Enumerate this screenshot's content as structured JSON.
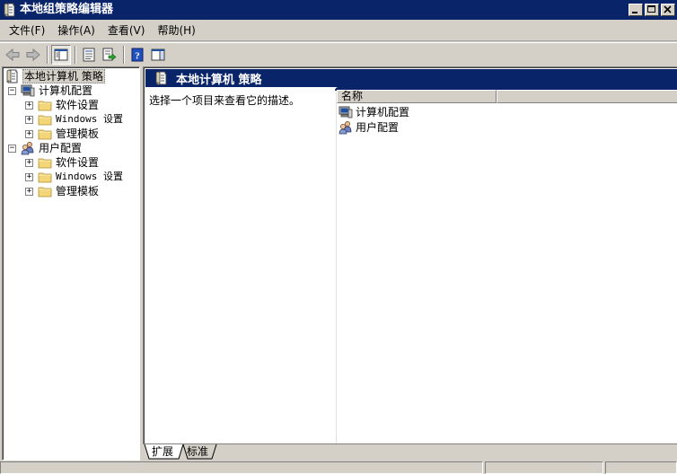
{
  "window": {
    "title": "本地组策略编辑器",
    "icon": "policy-document-icon",
    "buttons": [
      "minimize-icon",
      "maximize-icon",
      "close-icon"
    ]
  },
  "menu": [
    {
      "label": "文件(F)"
    },
    {
      "label": "操作(A)"
    },
    {
      "label": "查看(V)"
    },
    {
      "label": "帮助(H)"
    }
  ],
  "toolbar": {
    "buttons": [
      "back-arrow-icon",
      "forward-arrow-icon",
      "show-hide-tree-icon",
      "properties-icon",
      "export-list-icon",
      "help-icon",
      "show-hide-action-pane-icon"
    ]
  },
  "tree": {
    "root": {
      "label": "本地计算机 策略",
      "icon": "policy-document-icon",
      "selected": true
    },
    "nodes": [
      {
        "label": "计算机配置",
        "icon": "computer-icon",
        "expander": "−",
        "children": [
          {
            "label": "软件设置",
            "icon": "folder-icon",
            "expander": "+"
          },
          {
            "label": "Windows 设置",
            "icon": "folder-icon",
            "expander": "+"
          },
          {
            "label": "管理模板",
            "icon": "folder-icon",
            "expander": "+"
          }
        ]
      },
      {
        "label": "用户配置",
        "icon": "users-icon",
        "expander": "−",
        "children": [
          {
            "label": "软件设置",
            "icon": "folder-icon",
            "expander": "+"
          },
          {
            "label": "Windows 设置",
            "icon": "folder-icon",
            "expander": "+"
          },
          {
            "label": "管理模板",
            "icon": "folder-icon",
            "expander": "+"
          }
        ]
      }
    ]
  },
  "details": {
    "header": "本地计算机 策略",
    "description": "选择一个项目来查看它的描述。",
    "columns": [
      {
        "label": "名称"
      },
      {
        "label": ""
      }
    ],
    "items": [
      {
        "label": "计算机配置",
        "icon": "computer-icon"
      },
      {
        "label": "用户配置",
        "icon": "users-icon"
      }
    ]
  },
  "tabs": [
    {
      "label": "扩展",
      "active": true
    },
    {
      "label": "标准",
      "active": false
    }
  ],
  "colors": {
    "title_bar": "#0a246a",
    "face": "#d4d0c8",
    "folder": "#f4d67a"
  }
}
